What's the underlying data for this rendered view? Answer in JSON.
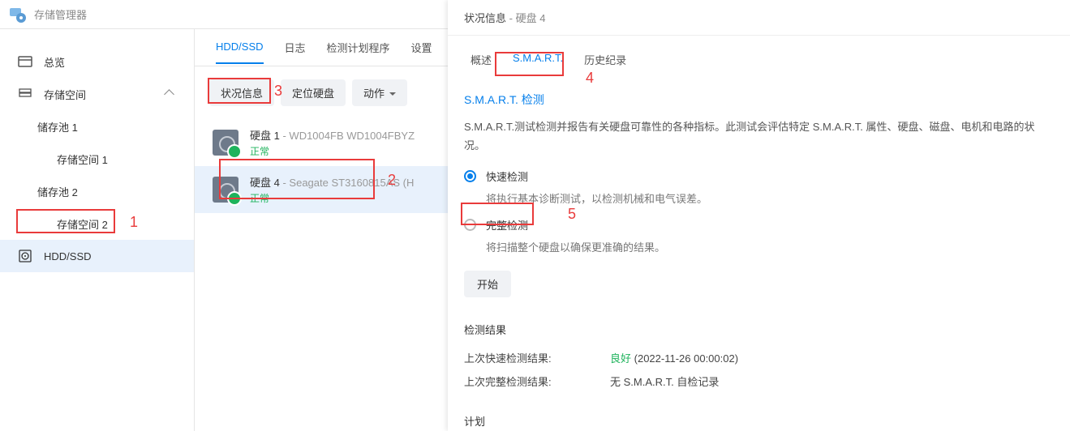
{
  "app": {
    "title": "存储管理器"
  },
  "sidebar": {
    "overview": "总览",
    "storage": "存储空间",
    "pool1": "储存池 1",
    "vol1": "存储空间 1",
    "pool2": "储存池 2",
    "vol2": "存储空间 2",
    "hdd": "HDD/SSD"
  },
  "tabs": {
    "hdd": "HDD/SSD",
    "log": "日志",
    "schedule": "检测计划程序",
    "settings": "设置"
  },
  "toolbar": {
    "health": "状况信息",
    "locate": "定位硬盘",
    "action": "动作"
  },
  "disks": [
    {
      "name": "硬盘 1",
      "model": "WD1004FB WD1004FBYZ",
      "status": "正常"
    },
    {
      "name": "硬盘 4",
      "model": "Seagate ST3160815AS (H",
      "status": "正常"
    }
  ],
  "panel": {
    "title": "状况信息",
    "subtitle": "硬盘 4",
    "tabs": {
      "overview": "概述",
      "smart": "S.M.A.R.T.",
      "history": "历史纪录"
    },
    "section": "S.M.A.R.T. 检测",
    "desc": "S.M.A.R.T.测试检测并报告有关硬盘可靠性的各种指标。此测试会评估特定 S.M.A.R.T. 属性、硬盘、磁盘、电机和电路的状况。",
    "quick": {
      "label": "快速检测",
      "desc": "将执行基本诊断测试，以检测机械和电气误差。"
    },
    "full": {
      "label": "完整检测",
      "desc": "将扫描整个硬盘以确保更准确的结果。"
    },
    "start": "开始",
    "results": {
      "title": "检测结果",
      "quickLabel": "上次快速检测结果:",
      "quickGood": "良好",
      "quickTime": "2022-11-26 00:00:02",
      "fullLabel": "上次完整检测结果:",
      "fullValue": "无 S.M.A.R.T. 自检记录"
    },
    "plan": "计划"
  },
  "annot": {
    "n1": "1",
    "n2": "2",
    "n3": "3",
    "n4": "4",
    "n5": "5"
  }
}
